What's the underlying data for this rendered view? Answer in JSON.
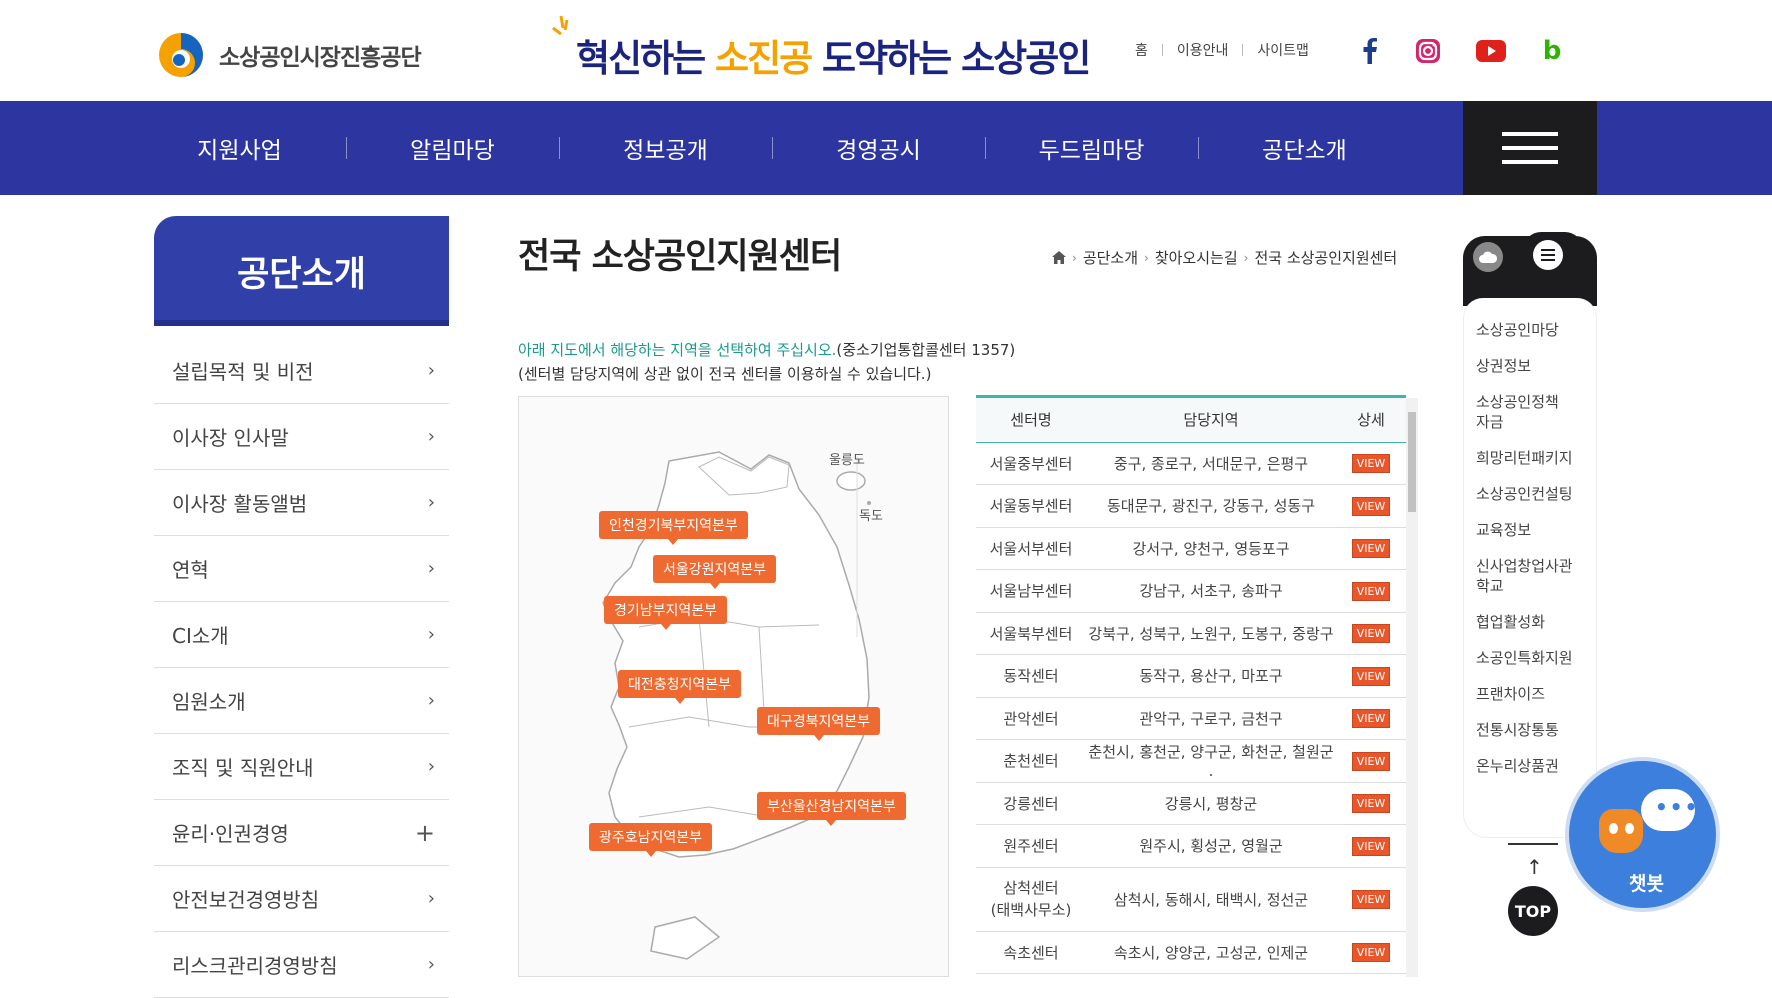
{
  "header": {
    "logo_text": "소상공인시장진흥공단",
    "slogan_part1": "혁신하는 ",
    "slogan_part2": "소진공",
    "slogan_part3": " 도약하는 ",
    "slogan_part4": "소상공인",
    "util_links": [
      "홈",
      "이용안내",
      "사이트맵"
    ],
    "sns": [
      "facebook-icon",
      "instagram-icon",
      "youtube-icon",
      "blog-icon"
    ],
    "colors": {
      "navy": "#1a237e",
      "gold": "#f5a200",
      "gnb": "#2d35a0",
      "teal": "#1a9a8c",
      "view": "#e8562a"
    }
  },
  "gnb": {
    "items": [
      "지원사업",
      "알림마당",
      "정보공개",
      "경영공시",
      "두드림마당",
      "공단소개"
    ]
  },
  "sidebar": {
    "title": "공단소개",
    "items": [
      {
        "label": "설립목적 및 비전",
        "icon": "chevron-right-icon"
      },
      {
        "label": "이사장 인사말",
        "icon": "chevron-right-icon"
      },
      {
        "label": "이사장 활동앨범",
        "icon": "chevron-right-icon"
      },
      {
        "label": "연혁",
        "icon": "chevron-right-icon"
      },
      {
        "label": "CI소개",
        "icon": "chevron-right-icon"
      },
      {
        "label": "임원소개",
        "icon": "chevron-right-icon"
      },
      {
        "label": "조직 및 직원안내",
        "icon": "chevron-right-icon"
      },
      {
        "label": "윤리·인권경영",
        "icon": "plus-icon"
      },
      {
        "label": "안전보건경영방침",
        "icon": "chevron-right-icon"
      },
      {
        "label": "리스크관리경영방침",
        "icon": "chevron-right-icon"
      }
    ]
  },
  "main": {
    "title": "전국 소상공인지원센터",
    "breadcrumb": [
      "공단소개",
      "찾아오시는길",
      "전국 소상공인지원센터"
    ],
    "guide_highlight": "아래 지도에서 해당하는 지역을 선택하여 주십시오.",
    "guide_tail": "(중소기업통합콜센터 1357)",
    "guide2": "(센터별 담당지역에 상관 없이 전국 센터를 이용하실 수 있습니다.)",
    "map": {
      "islands": [
        "울릉도",
        "독도"
      ],
      "regions": [
        "인천경기북부지역본부",
        "서울강원지역본부",
        "경기남부지역본부",
        "대전충청지역본부",
        "대구경북지역본부",
        "부산울산경남지역본부",
        "광주호남지역본부"
      ]
    },
    "table": {
      "headers": [
        "센터명",
        "담당지역",
        "상세"
      ],
      "view_label": "VIEW",
      "rows": [
        {
          "name": "서울중부센터",
          "area": "중구, 종로구, 서대문구, 은평구"
        },
        {
          "name": "서울동부센터",
          "area": "동대문구, 광진구, 강동구, 성동구"
        },
        {
          "name": "서울서부센터",
          "area": "강서구, 양천구, 영등포구"
        },
        {
          "name": "서울남부센터",
          "area": "강남구, 서초구, 송파구"
        },
        {
          "name": "서울북부센터",
          "area": "강북구, 성북구, 노원구, 도봉구, 중랑구"
        },
        {
          "name": "동작센터",
          "area": "동작구, 용산구, 마포구"
        },
        {
          "name": "관악센터",
          "area": "관악구, 구로구, 금천구"
        },
        {
          "name": "춘천센터",
          "area": "춘천시, 홍천군, 양구군, 화천군, 철원군 ."
        },
        {
          "name": "강릉센터",
          "area": "강릉시, 평창군"
        },
        {
          "name": "원주센터",
          "area": "원주시, 횡성군, 영월군"
        },
        {
          "name": "삼척센터\n(태백사무소)",
          "area": "삼척시, 동해시, 태백시, 정선군"
        },
        {
          "name": "속초센터",
          "area": "속초시, 양양군, 고성군, 인제군"
        }
      ]
    }
  },
  "quick_menu": {
    "items": [
      "소상공인마당",
      "상권정보",
      "소상공인정책\n자금",
      "희망리턴패키지",
      "소상공인컨설팅",
      "교육정보",
      "신사업창업사관\n학교",
      "협업활성화",
      "소공인특화지원",
      "프랜차이즈",
      "전통시장통통",
      "온누리상품권"
    ]
  },
  "top_label": "TOP",
  "chatbot_label": "챗봇"
}
